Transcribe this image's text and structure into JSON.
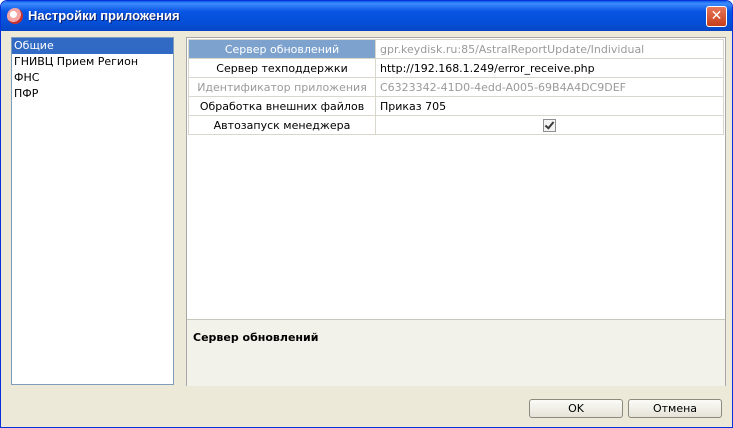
{
  "window": {
    "title": "Настройки приложения",
    "close_glyph": "✕"
  },
  "nav": {
    "items": [
      {
        "label": "Общие",
        "selected": true
      },
      {
        "label": "ГНИВЦ Прием Регион",
        "selected": false
      },
      {
        "label": "ФНС",
        "selected": false
      },
      {
        "label": "ПФР",
        "selected": false
      }
    ]
  },
  "properties": [
    {
      "name": "Сервер обновлений",
      "value": "gpr.keydisk.ru:85/AstralReportUpdate/Individual",
      "state": "selected"
    },
    {
      "name": "Сервер техподдержки",
      "value": "http://192.168.1.249/error_receive.php",
      "state": "normal"
    },
    {
      "name": "Идентификатор приложения",
      "value": "C6323342-41D0-4edd-A005-69B4A4DC9DEF",
      "state": "disabled"
    },
    {
      "name": "Обработка внешних файлов",
      "value": "Приказ 705",
      "state": "normal"
    },
    {
      "name": "Автозапуск менеджера",
      "checked": true,
      "state": "normal"
    }
  ],
  "description": {
    "title": "Сервер обновлений"
  },
  "buttons": {
    "ok": "OK",
    "cancel": "Отмена"
  }
}
